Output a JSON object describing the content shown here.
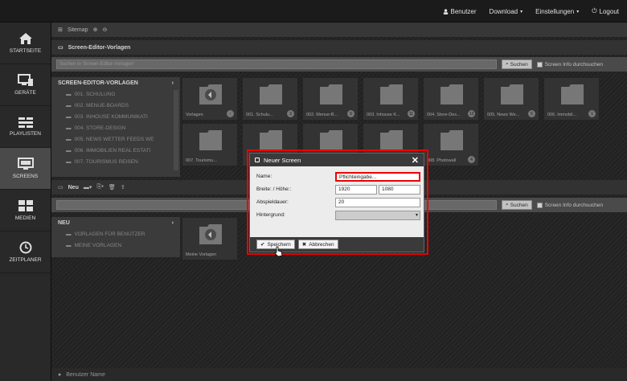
{
  "topnav": {
    "user": "Benutzer",
    "download": "Download",
    "settings": "Einstellungen",
    "logout": "Logout"
  },
  "sidebar": {
    "items": [
      {
        "label": "STARTSEITE",
        "icon": "home-icon"
      },
      {
        "label": "GERÄTE",
        "icon": "devices-icon"
      },
      {
        "label": "PLAYLISTEN",
        "icon": "playlist-icon"
      },
      {
        "label": "SCREENS",
        "icon": "screens-icon",
        "active": true
      },
      {
        "label": "MEDIEN",
        "icon": "media-icon"
      },
      {
        "label": "ZEITPLANER",
        "icon": "clock-icon"
      }
    ]
  },
  "breadcrumb": {
    "sitemap": "Sitemap"
  },
  "templates_panel": {
    "title": "Screen-Editor-Vorlagen",
    "search_placeholder": "Suchen in 'Screen-Editor-Vorlagen'",
    "search_button": "Suchen",
    "checkbox": "Screen Info durchsuchen"
  },
  "template_tree": {
    "head": "SCREEN-EDITOR-VORLAGEN",
    "items": [
      "001. SCHULUNG",
      "002. MENUE-BOARDS",
      "003. INHOUSE KOMMUNIKATI",
      "004. STORE-DESIGN",
      "005. NEWS WETTER FEEDS WE",
      "006. IMMOBILIEN REAL ESTATI",
      "007. TOURISMUS REISEN"
    ]
  },
  "template_tiles": [
    "Vorlagen",
    "001. Schulu...",
    "002. Menue-B...",
    "003. Inhouse K...",
    "004. Store-Des...",
    "005. News We...",
    "006. Immobil...",
    "007. Tourismu...",
    "",
    "",
    "",
    "008. Photowall"
  ],
  "template_badges": [
    "",
    "3",
    "9",
    "11",
    "13",
    "5",
    "1",
    "",
    "",
    "",
    "",
    "4"
  ],
  "user_panel": {
    "new": "Neu",
    "search_button": "Suchen",
    "checkbox": "Screen Info durchsuchen"
  },
  "user_tree": {
    "head": "NEU",
    "items": [
      "VORLAGEN FÜR BENUTZER",
      "MEINE VORLAGEN"
    ]
  },
  "user_tiles": [
    "Meine Vorlagen"
  ],
  "bottom": {
    "username": "Benutzer Name"
  },
  "dialog": {
    "title": "Neuer Screen",
    "name_label": "Name:",
    "name_placeholder": "Pflichteingabe...",
    "size_label": "Breite: / Höhe::",
    "width": "1920",
    "height": "1080",
    "duration_label": "Abspieldauer:",
    "duration": "20",
    "background_label": "Hintergrund:",
    "save": "Speichern",
    "cancel": "Abbrechen"
  },
  "colors": {
    "highlight": "#e00000",
    "active_nav": "#555555"
  }
}
